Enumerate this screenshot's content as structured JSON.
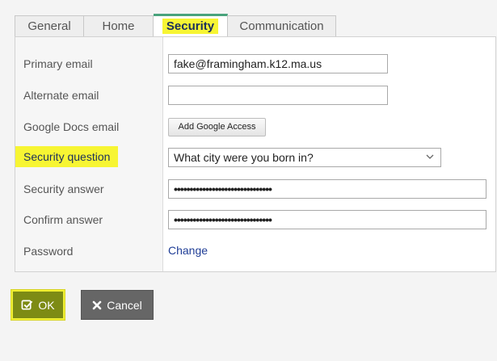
{
  "tabs": [
    {
      "label": "General"
    },
    {
      "label": "Home"
    },
    {
      "label": "Security",
      "active": true
    },
    {
      "label": "Communication"
    }
  ],
  "form": {
    "primary_email": {
      "label": "Primary email",
      "value": "fake@framingham.k12.ma.us"
    },
    "alternate_email": {
      "label": "Alternate email",
      "value": ""
    },
    "google_docs_email": {
      "label": "Google Docs email",
      "button_label": "Add Google Access"
    },
    "security_question": {
      "label": "Security question",
      "selected": "What city were you born in?"
    },
    "security_answer": {
      "label": "Security answer",
      "value": "•••••••••••••••••••••••••••••••"
    },
    "confirm_answer": {
      "label": "Confirm answer",
      "value": "•••••••••••••••••••••••••••••••"
    },
    "password": {
      "label": "Password",
      "link_label": "Change"
    }
  },
  "buttons": {
    "ok_label": "OK",
    "cancel_label": "Cancel"
  },
  "colors": {
    "highlight": "#f7f533",
    "active_tab_border": "#49a37c",
    "ok_button": "#7d8b14",
    "cancel_button": "#666666",
    "link": "#1f3d96"
  },
  "icons": {
    "ok": "check-square-icon",
    "cancel": "x-icon",
    "select": "chevron-down-icon"
  }
}
